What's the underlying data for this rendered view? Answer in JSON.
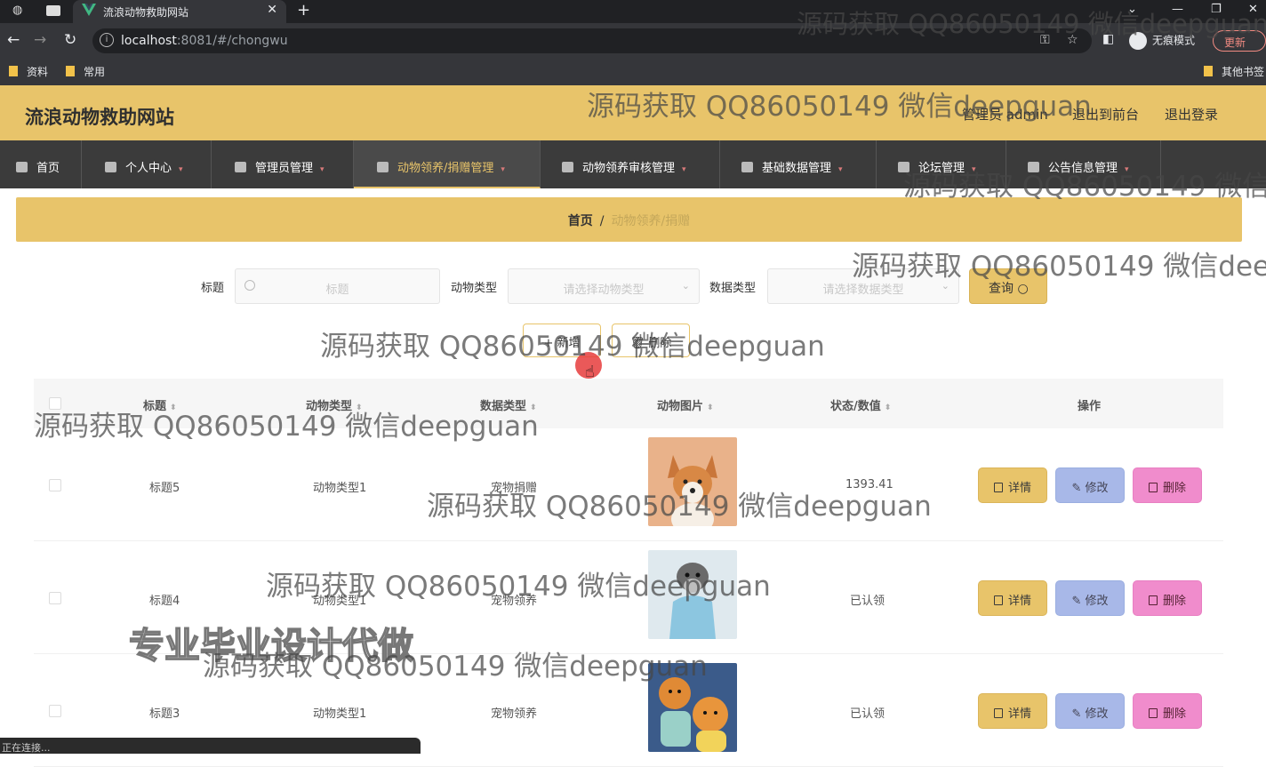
{
  "browser": {
    "tab_title": "流浪动物救助网站",
    "url_host": "localhost",
    "url_rest": ":8081/#/chongwu",
    "incognito_label": "无痕模式",
    "update_label": "更新",
    "bookmarks": [
      "资料",
      "常用"
    ],
    "other_bookmarks": "其他书签",
    "status_text": "正在连接..."
  },
  "header": {
    "brand": "流浪动物救助网站",
    "user": "管理员 admin",
    "to_front": "退出到前台",
    "logout": "退出登录"
  },
  "nav": [
    "首页",
    "个人中心",
    "管理员管理",
    "动物领养/捐赠管理",
    "动物领养审核管理",
    "基础数据管理",
    "论坛管理",
    "公告信息管理"
  ],
  "breadcrumb": {
    "home": "首页",
    "sep": "/",
    "current": "动物领养/捐赠"
  },
  "search": {
    "title_label": "标题",
    "title_placeholder": "标题",
    "type_label": "动物类型",
    "type_placeholder": "请选择动物类型",
    "data_label": "数据类型",
    "data_placeholder": "请选择数据类型",
    "query_label": "查询"
  },
  "actions": {
    "add": "新增",
    "delete": "删除"
  },
  "table": {
    "headers": [
      "标题",
      "动物类型",
      "数据类型",
      "动物图片",
      "状态/数值",
      "操作"
    ],
    "rows": [
      {
        "title": "标题5",
        "type": "动物类型1",
        "data_type": "宠物捐赠",
        "status": "1393.41"
      },
      {
        "title": "标题4",
        "type": "动物类型1",
        "data_type": "宠物领养",
        "status": "已认领"
      },
      {
        "title": "标题3",
        "type": "动物类型1",
        "data_type": "宠物领养",
        "status": "已认领"
      }
    ],
    "btn_detail": "详情",
    "btn_edit": "修改",
    "btn_delete": "删除"
  },
  "watermark": "源码获取 QQ86050149 微信deepguan",
  "watermark_big": "专业毕业设计代做",
  "colors": {
    "accent": "#e8c46a",
    "nav_bg": "#3b3b3b",
    "edit": "#a8b8e8",
    "delete": "#f08ccc"
  }
}
